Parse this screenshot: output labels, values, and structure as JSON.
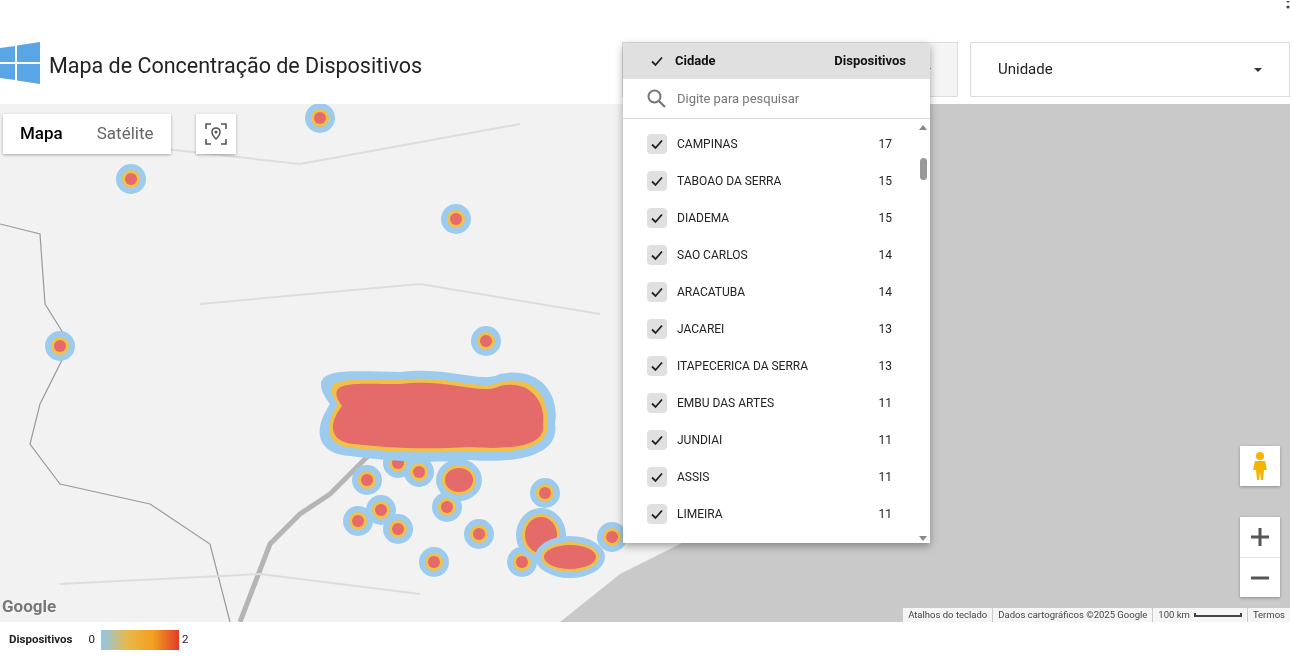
{
  "header": {
    "title": "Mapa de Concentração de Dispositivos"
  },
  "city_filter": {
    "expanded": true,
    "header": {
      "checked": true,
      "column_1": "Cidade",
      "column_2": "Dispositivos"
    },
    "search": {
      "placeholder": "Digite para pesquisar"
    },
    "options": [
      {
        "name": "CAMPINAS",
        "count": "17",
        "checked": true
      },
      {
        "name": "TABOAO DA SERRA",
        "count": "15",
        "checked": true
      },
      {
        "name": "DIADEMA",
        "count": "15",
        "checked": true
      },
      {
        "name": "SAO CARLOS",
        "count": "14",
        "checked": true
      },
      {
        "name": "ARACATUBA",
        "count": "14",
        "checked": true
      },
      {
        "name": "JACAREI",
        "count": "13",
        "checked": true
      },
      {
        "name": "ITAPECERICA DA SERRA",
        "count": "13",
        "checked": true
      },
      {
        "name": "EMBU DAS ARTES",
        "count": "11",
        "checked": true
      },
      {
        "name": "JUNDIAI",
        "count": "11",
        "checked": true
      },
      {
        "name": "ASSIS",
        "count": "11",
        "checked": true
      },
      {
        "name": "LIMEIRA",
        "count": "11",
        "checked": true
      }
    ]
  },
  "unit_filter": {
    "label": "Unidade"
  },
  "map": {
    "type_buttons": [
      {
        "label": "Mapa",
        "selected": true
      },
      {
        "label": "Satélite",
        "selected": false
      }
    ],
    "logo": "Google",
    "attribution": [
      "Atalhos do teclado",
      "Dados cartográficos ©2025 Google",
      "100 km",
      "Termos"
    ]
  },
  "legend": {
    "title": "Dispositivos",
    "min": "0",
    "max": "2"
  }
}
